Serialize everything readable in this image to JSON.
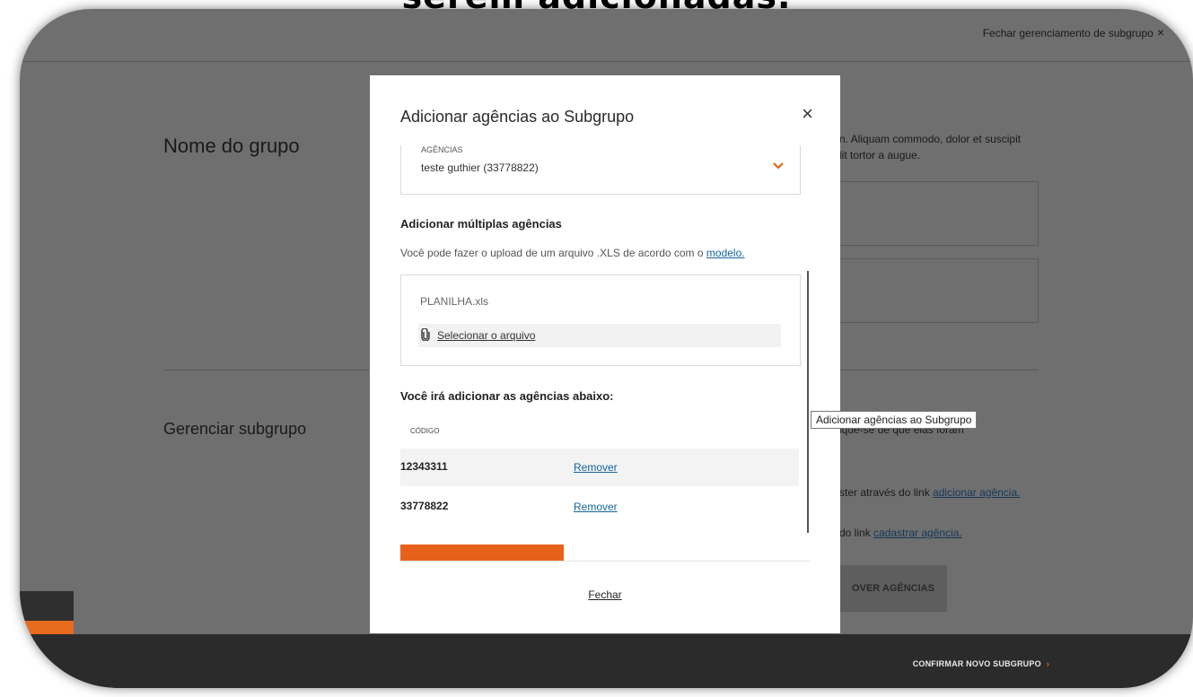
{
  "caption": "serem adicionadas.",
  "header": {
    "close_label": "Fechar gerenciamento de subgrupo",
    "close_icon": "×"
  },
  "sections": {
    "group_name_title": "Nome do grupo",
    "manage_subgroup_title": "Gerenciar subgrupo"
  },
  "right_column": {
    "lorem_line1": "n. Aliquam commodo, dolor et suscipit",
    "lorem_line2": "lit tortor a augue.",
    "check_text": "ique-se de que elas foram",
    "register_text": "ster através do link",
    "register_link": "adicionar agência.",
    "cadastrar_text": "do link",
    "cadastrar_link": "cadastrar agência.",
    "remove_button": "OVER AGÊNCIAS"
  },
  "footer": {
    "confirm_label": "CONFIRMAR NOVO SUBGRUPO",
    "chevron": "›"
  },
  "modal": {
    "title": "Adicionar agências ao Subgrupo",
    "close_icon": "×",
    "select": {
      "label": "AGÊNCIAS",
      "value": "teste guthier (33778822)"
    },
    "multi_title": "Adicionar múltiplas agências",
    "multi_desc": "Você pode fazer o upload de um arquivo .XLS de acordo com o",
    "multi_link": "modelo.",
    "file_name": "PLANILHA.xls",
    "select_file_label": "Selecionar o arquivo",
    "list_title": "Você irá adicionar as agências abaixo:",
    "column_header": "CÓDIGO",
    "rows": [
      {
        "code": "12343311",
        "action": "Remover"
      },
      {
        "code": "33778822",
        "action": "Remover"
      }
    ],
    "close_label": "Fechar"
  },
  "tooltip": "Adicionar agências ao Subgrupo",
  "colors": {
    "accent": "#e8611a",
    "link": "#1565a0",
    "overlay_page": "#6f6f6f",
    "footer": "#2b2b2b"
  }
}
